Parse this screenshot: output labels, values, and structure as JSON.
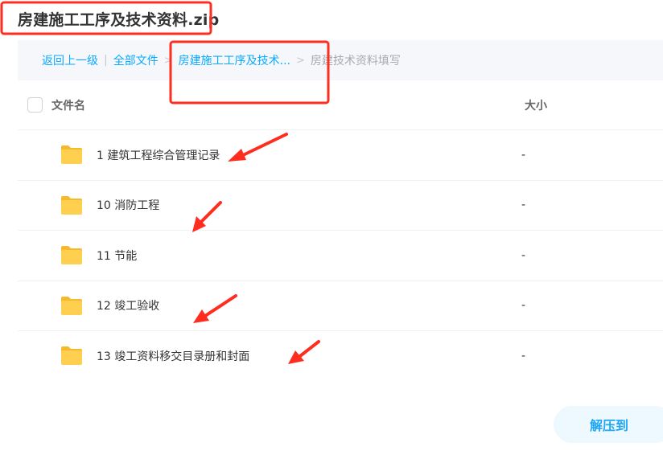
{
  "title": "房建施工工序及技术资料.zip",
  "breadcrumb": {
    "back": "返回上一级",
    "separator": "|",
    "chevron": ">",
    "items": [
      "全部文件",
      "房建施工工序及技术...",
      "房建技术资料填写"
    ]
  },
  "table": {
    "headers": {
      "name": "文件名",
      "size": "大小"
    },
    "rows": [
      {
        "name": "1 建筑工程综合管理记录",
        "size": "-",
        "icon": "folder-icon"
      },
      {
        "name": "10 消防工程",
        "size": "-",
        "icon": "folder-icon"
      },
      {
        "name": "11 节能",
        "size": "-",
        "icon": "folder-icon"
      },
      {
        "name": "12 竣工验收",
        "size": "-",
        "icon": "folder-icon"
      },
      {
        "name": "13 竣工资料移交目录册和封面",
        "size": "-",
        "icon": "folder-icon"
      }
    ]
  },
  "actions": {
    "extract_label": "解压到"
  },
  "colors": {
    "accent": "#09aaff",
    "folder": "#ffd04f",
    "annotation": "#ff2d20",
    "breadcrumb_bg": "#f6f7fa",
    "button_bg": "#eef8ff"
  }
}
